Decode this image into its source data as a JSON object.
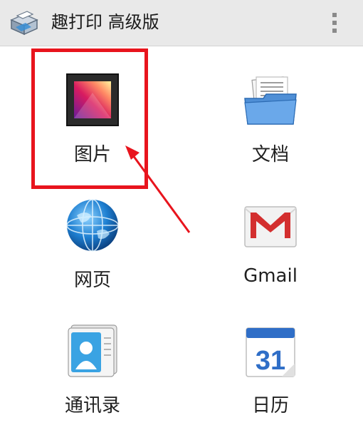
{
  "actionbar": {
    "title": "趣打印 高级版",
    "app_icon": "printer-icon",
    "menu_icon": "overflow-menu-icon"
  },
  "grid": {
    "items": [
      {
        "label": "图片",
        "icon": "gallery-icon"
      },
      {
        "label": "文档",
        "icon": "folder-documents-icon"
      },
      {
        "label": "网页",
        "icon": "globe-icon"
      },
      {
        "label": "Gmail",
        "icon": "gmail-icon"
      },
      {
        "label": "通讯录",
        "icon": "contacts-icon"
      },
      {
        "label": "日历",
        "icon": "calendar-icon"
      }
    ]
  },
  "calendar_icon_day": "31",
  "colors": {
    "highlight": "#e8141d",
    "arrow": "#e8141d",
    "actionbar": "#e9e9e9"
  }
}
